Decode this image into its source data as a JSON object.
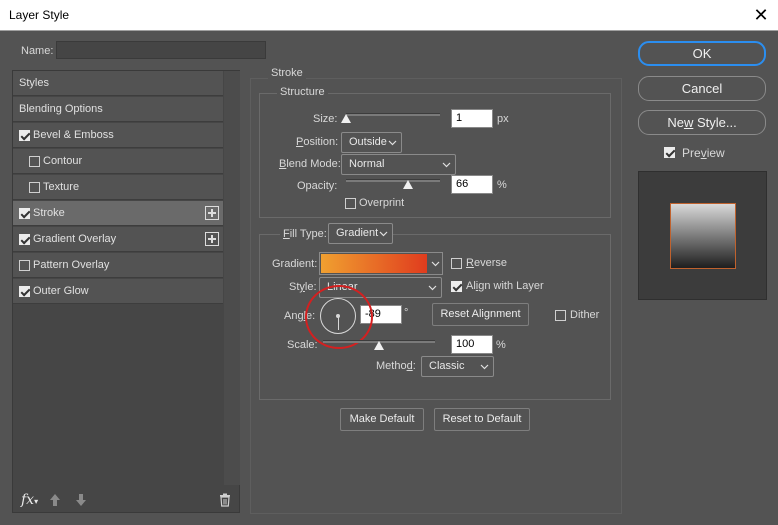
{
  "window": {
    "title": "Layer Style",
    "close_glyph": "✕"
  },
  "name_field": {
    "label": "Name:",
    "value": ""
  },
  "styles_list": [
    {
      "label": "Styles",
      "checkbox": false,
      "checked": false,
      "plus": false,
      "selected": false,
      "indent": false
    },
    {
      "label": "Blending Options",
      "checkbox": false,
      "checked": false,
      "plus": false,
      "selected": false,
      "indent": false
    },
    {
      "label": "Bevel & Emboss",
      "checkbox": true,
      "checked": true,
      "plus": false,
      "selected": false,
      "indent": false
    },
    {
      "label": "Contour",
      "checkbox": true,
      "checked": false,
      "plus": false,
      "selected": false,
      "indent": true
    },
    {
      "label": "Texture",
      "checkbox": true,
      "checked": false,
      "plus": false,
      "selected": false,
      "indent": true
    },
    {
      "label": "Stroke",
      "checkbox": true,
      "checked": true,
      "plus": true,
      "selected": true,
      "indent": false
    },
    {
      "label": "Gradient Overlay",
      "checkbox": true,
      "checked": true,
      "plus": true,
      "selected": false,
      "indent": false
    },
    {
      "label": "Pattern Overlay",
      "checkbox": true,
      "checked": false,
      "plus": false,
      "selected": false,
      "indent": false
    },
    {
      "label": "Outer Glow",
      "checkbox": true,
      "checked": true,
      "plus": false,
      "selected": false,
      "indent": false
    }
  ],
  "bottom_toolbar": {
    "fx_label": "fx"
  },
  "stroke": {
    "section_title": "Stroke",
    "structure_title": "Structure",
    "size": {
      "label": "Size:",
      "value": "1",
      "unit": "px",
      "fraction": 0.0
    },
    "position": {
      "label": "Position:",
      "value": "Outside"
    },
    "blend_mode": {
      "label": "Blend Mode:",
      "value": "Normal"
    },
    "opacity": {
      "label": "Opacity:",
      "value": "66",
      "unit": "%",
      "fraction": 0.66
    },
    "overprint": {
      "label": "Overprint",
      "checked": false
    }
  },
  "fill": {
    "fill_type_label": "Fill Type:",
    "fill_type_value": "Gradient",
    "gradient_label": "Gradient:",
    "gradient_colors": [
      "#f0a030",
      "#e03c1e"
    ],
    "reverse": {
      "label": "Reverse",
      "checked": false
    },
    "style_label": "Style:",
    "style_value": "Linear",
    "align": {
      "label": "Align with Layer",
      "checked": true
    },
    "angle_label": "Angle:",
    "angle_value": "-89",
    "angle_unit": "°",
    "reset_alignment": "Reset Alignment",
    "dither": {
      "label": "Dither",
      "checked": false
    },
    "scale_label": "Scale:",
    "scale_value": "100",
    "scale_unit": "%",
    "scale_fraction": 0.5,
    "method_label": "Method:",
    "method_value": "Classic"
  },
  "footer": {
    "make_default": "Make Default",
    "reset_default": "Reset to Default"
  },
  "right": {
    "ok": "OK",
    "cancel": "Cancel",
    "new_style": "New Style...",
    "preview": {
      "label": "Preview",
      "checked": true
    }
  },
  "colors": {
    "accent": "#2b8ef0",
    "annotation_circle": "#d42020",
    "panel": "#535353"
  }
}
